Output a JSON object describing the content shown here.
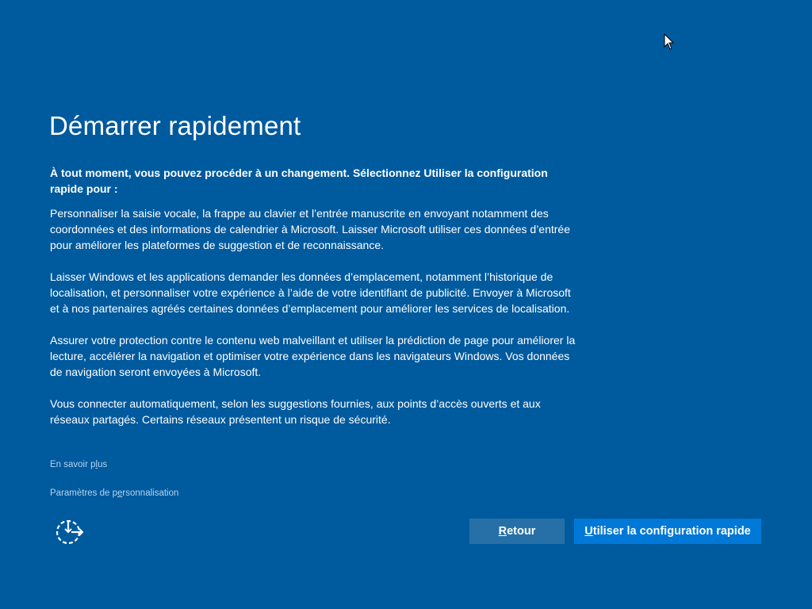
{
  "title": "Démarrer rapidement",
  "intro": "À tout moment, vous pouvez procéder à un changement. Sélectionnez Utiliser la configuration rapide pour :",
  "paragraphs": [
    "Personnaliser la saisie vocale, la frappe au clavier et l’entrée manuscrite en envoyant notamment des coordonnées et des informations de calendrier à Microsoft. Laisser Microsoft utiliser ces données d’entrée pour améliorer les plateformes de suggestion et de reconnaissance.",
    "Laisser Windows et les applications demander les données d’emplacement, notamment l’historique de localisation, et personnaliser votre expérience à l’aide de votre identifiant de publicité. Envoyer à Microsoft et à nos partenaires agréés certaines données d’emplacement pour améliorer les services de localisation.",
    "Assurer votre protection contre le contenu web malveillant et utiliser la prédiction de page pour améliorer la lecture, accélérer la navigation et optimiser votre expérience dans les navigateurs Windows. Vos données de navigation seront envoyées à Microsoft.",
    "Vous connecter automatiquement, selon les suggestions fournies, aux points d’accès ouverts et aux réseaux partagés. Certains réseaux présentent un risque de sécurité."
  ],
  "links": {
    "learn_more": [
      "En savoir p",
      "l",
      "us"
    ],
    "customize": [
      "Paramètres de p",
      "e",
      "rsonnalisation"
    ]
  },
  "buttons": {
    "back": "Retour",
    "express": "Utiliser la configuration rapide"
  },
  "icons": {
    "accessibility": "ease-of-access-icon"
  }
}
